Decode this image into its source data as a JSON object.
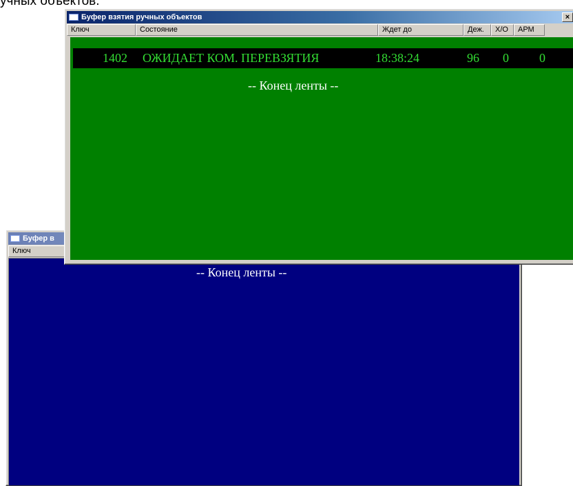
{
  "caption_fragment": "учных объектов.",
  "colors": {
    "active_list_bg": "#008000",
    "record_text": "#33dd33",
    "record_bg": "#000000",
    "inactive_list_bg": "#000080",
    "end_text": "#ffffff"
  },
  "window_front": {
    "title": "Буфер взятия ручных объектов",
    "close_icon": "close-icon",
    "columns": [
      "Ключ",
      "Состояние",
      "Ждет до",
      "Деж.",
      "Х/О",
      "АРМ"
    ],
    "rows": [
      {
        "key": "1402",
        "state": "ОЖИДАЕТ КОМ. ПЕРЕВЗЯТИЯ",
        "wait_until": "18:38:24",
        "duty": "96",
        "ho": "0",
        "arm": "0"
      }
    ],
    "end_text": "-- Конец ленты --"
  },
  "window_back": {
    "title": "Буфер в",
    "columns": [
      "Ключ"
    ],
    "end_text": "-- Конец ленты --"
  }
}
